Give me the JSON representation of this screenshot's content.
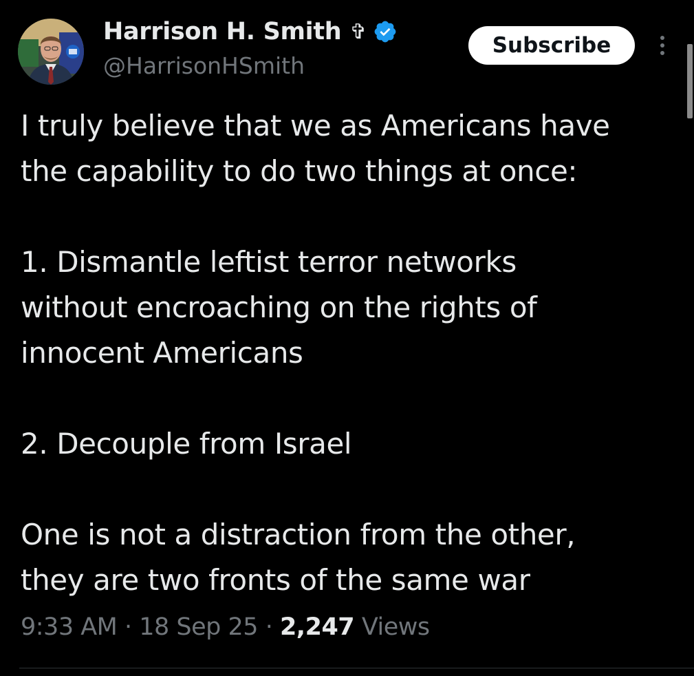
{
  "author": {
    "display_name": "Harrison H. Smith",
    "cross_symbol": "✞",
    "handle": "@HarrisonHSmith",
    "verified": true,
    "verified_color": "#1d9bf0"
  },
  "header": {
    "subscribe_label": "Subscribe",
    "more_icon": "more-vertical-icon"
  },
  "tweet": {
    "lines": [
      "I truly believe that we as Americans have",
      "the capability to do two things at once:",
      "",
      "1. Dismantle leftist terror networks",
      "without encroaching on the rights of",
      "innocent Americans",
      "",
      "2. Decouple from Israel",
      "",
      "One is not a distraction from the other,",
      "they are two fronts of the same war"
    ]
  },
  "meta": {
    "time": "9:33 AM",
    "separator": " · ",
    "date": "18 Sep 25",
    "views_count": "2,247",
    "views_label": "Views"
  },
  "colors": {
    "background": "#000000",
    "text_primary": "#e7e9ea",
    "text_secondary": "#71767b",
    "button_bg": "#ffffff",
    "button_text": "#0f1419",
    "divider": "#2f3336"
  }
}
